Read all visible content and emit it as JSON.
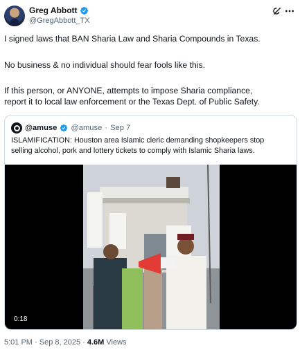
{
  "author": {
    "name": "Greg Abbott",
    "handle": "@GregAbbott_TX"
  },
  "icons": {
    "verified": "verified-badge-icon",
    "grok": "grok-icon",
    "more": "more-options-icon"
  },
  "tweet": {
    "paragraph_1": "I signed laws that BAN Sharia Law and Sharia Compounds in Texas.",
    "paragraph_2": "No business & no individual should fear fools like this.",
    "paragraph_3_line_1": "If this person, or ANYONE, attempts to impose Sharia compliance,",
    "paragraph_3_line_2": "report it to local law enforcement or the Texas Dept. of Public Safety."
  },
  "quote": {
    "name": "@amuse",
    "handle": "@amuse",
    "separator": "·",
    "date": "Sep 7",
    "text_line_1": "ISLAMIFICATION: Houston area Islamic cleric demanding shopkeepers stop",
    "text_line_2": "selling alcohol, pork and lottery tickets to comply with Islamic Sharia laws.",
    "video_duration": "0:18"
  },
  "meta": {
    "time": "5:01 PM",
    "separator_1": " · ",
    "date": "Sep 8, 2025",
    "separator_2": " · ",
    "views_count": "4.6M",
    "views_label": " Views"
  },
  "colors": {
    "verified_blue": "#1d9bf0",
    "secondary_text": "#536471",
    "primary_text": "#0f1419",
    "border": "#cfd9de"
  }
}
